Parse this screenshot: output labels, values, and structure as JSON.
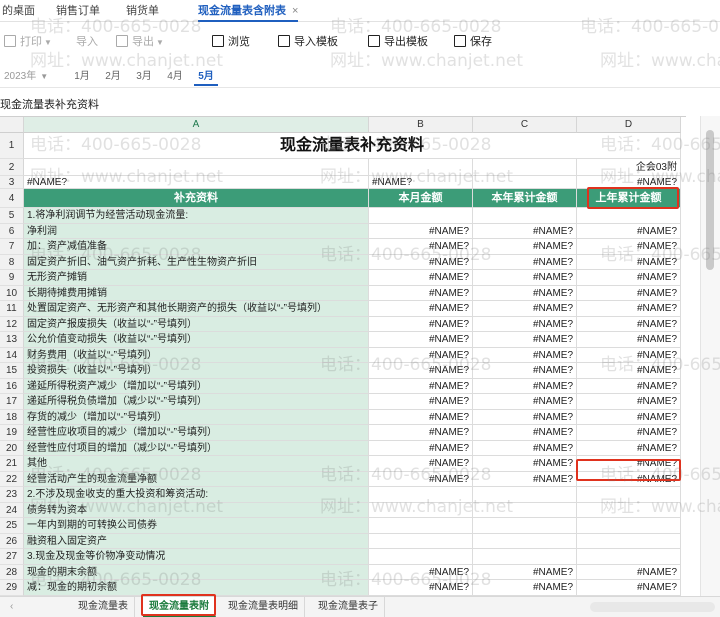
{
  "tabs": [
    {
      "label": "的桌面"
    },
    {
      "label": "销售订单"
    },
    {
      "label": "销货单"
    },
    {
      "label": "现金流量表含附表",
      "close": "×"
    }
  ],
  "toolbar": {
    "print": "打印",
    "import": "导入",
    "export": "导出",
    "browse": "浏览",
    "import_template": "导入模板",
    "export_template": "导出模板",
    "save": "保存"
  },
  "period": {
    "year": "2023年",
    "months": [
      "1月",
      "2月",
      "3月",
      "4月",
      "5月"
    ],
    "selected_month": "5月"
  },
  "formula_bar": {
    "text": "现金流量表补充资料"
  },
  "sheet": {
    "columns": [
      "A",
      "B",
      "C",
      "D"
    ],
    "title": "现金流量表补充资料",
    "form_code": "企会03附",
    "row3": {
      "a": "#NAME?",
      "b": "#NAME?",
      "d": "#NAME?"
    },
    "headers": [
      "补充资料",
      "本月金额",
      "本年累计金额",
      "上年累计金额"
    ],
    "rows": [
      {
        "n": "5",
        "label": "1.将净利润调节为经营活动现金流量:",
        "b": "",
        "c": "",
        "d": ""
      },
      {
        "n": "6",
        "label": "    净利润",
        "b": "#NAME?",
        "c": "#NAME?",
        "d": "#NAME?"
      },
      {
        "n": "7",
        "label": "    加：资产减值准备",
        "b": "#NAME?",
        "c": "#NAME?",
        "d": "#NAME?"
      },
      {
        "n": "8",
        "label": "    固定资产折旧、油气资产折耗、生产性生物资产折旧",
        "b": "#NAME?",
        "c": "#NAME?",
        "d": "#NAME?"
      },
      {
        "n": "9",
        "label": "    无形资产摊销",
        "b": "#NAME?",
        "c": "#NAME?",
        "d": "#NAME?"
      },
      {
        "n": "10",
        "label": "    长期待摊费用摊销",
        "b": "#NAME?",
        "c": "#NAME?",
        "d": "#NAME?"
      },
      {
        "n": "11",
        "label": "    处置固定资产、无形资产和其他长期资产的损失（收益以“-”号填列）",
        "b": "#NAME?",
        "c": "#NAME?",
        "d": "#NAME?"
      },
      {
        "n": "12",
        "label": "    固定资产报废损失（收益以“-”号填列）",
        "b": "#NAME?",
        "c": "#NAME?",
        "d": "#NAME?"
      },
      {
        "n": "13",
        "label": "    公允价值变动损失（收益以“-”号填列）",
        "b": "#NAME?",
        "c": "#NAME?",
        "d": "#NAME?"
      },
      {
        "n": "14",
        "label": "    财务费用（收益以“-”号填列）",
        "b": "#NAME?",
        "c": "#NAME?",
        "d": "#NAME?"
      },
      {
        "n": "15",
        "label": "    投资损失（收益以“-”号填列）",
        "b": "#NAME?",
        "c": "#NAME?",
        "d": "#NAME?"
      },
      {
        "n": "16",
        "label": "    递延所得税资产减少（增加以“-”号填列）",
        "b": "#NAME?",
        "c": "#NAME?",
        "d": "#NAME?"
      },
      {
        "n": "17",
        "label": "    递延所得税负债增加（减少以“-”号填列）",
        "b": "#NAME?",
        "c": "#NAME?",
        "d": "#NAME?"
      },
      {
        "n": "18",
        "label": "    存货的减少（增加以“-”号填列）",
        "b": "#NAME?",
        "c": "#NAME?",
        "d": "#NAME?"
      },
      {
        "n": "19",
        "label": "    经营性应收项目的减少（增加以“-”号填列）",
        "b": "#NAME?",
        "c": "#NAME?",
        "d": "#NAME?"
      },
      {
        "n": "20",
        "label": "    经营性应付项目的增加（减少以“-”号填列）",
        "b": "#NAME?",
        "c": "#NAME?",
        "d": "#NAME?"
      },
      {
        "n": "21",
        "label": "    其他",
        "b": "#NAME?",
        "c": "#NAME?",
        "d": "#NAME?"
      },
      {
        "n": "22",
        "label": "    经营活动产生的现金流量净额",
        "b": "#NAME?",
        "c": "#NAME?",
        "d": "#NAME?"
      },
      {
        "n": "23",
        "label": "2.不涉及现金收支的重大投资和筹资活动:",
        "b": "",
        "c": "",
        "d": ""
      },
      {
        "n": "24",
        "label": "    债务转为资本",
        "b": "",
        "c": "",
        "d": ""
      },
      {
        "n": "25",
        "label": "    一年内到期的可转换公司债券",
        "b": "",
        "c": "",
        "d": ""
      },
      {
        "n": "26",
        "label": "    融资租入固定资产",
        "b": "",
        "c": "",
        "d": ""
      },
      {
        "n": "27",
        "label": "3.现金及现金等价物净变动情况",
        "b": "",
        "c": "",
        "d": ""
      },
      {
        "n": "28",
        "label": "    现金的期末余额",
        "b": "#NAME?",
        "c": "#NAME?",
        "d": "#NAME?"
      },
      {
        "n": "29",
        "label": "    减：现金的期初余额",
        "b": "#NAME?",
        "c": "#NAME?",
        "d": "#NAME?"
      },
      {
        "n": "30",
        "label": "    加：现金等价物的期末余额",
        "b": "#NAME?",
        "c": "#NAME?",
        "d": "#NAME?"
      }
    ]
  },
  "sheet_tabs": [
    {
      "label": "现金流量表"
    },
    {
      "label": "现金流量表附"
    },
    {
      "label": "现金流量表明细"
    },
    {
      "label": "现金流量表子"
    }
  ],
  "active_sheet": "现金流量表附",
  "watermark": {
    "phone": "电话：400-665-0028",
    "site": "网址：www.chanjet.net"
  },
  "colors": {
    "accent": "#1f5fbf",
    "header_green": "#3c9c78",
    "label_fill": "#d9ede2",
    "highlight": "#e0321e"
  }
}
